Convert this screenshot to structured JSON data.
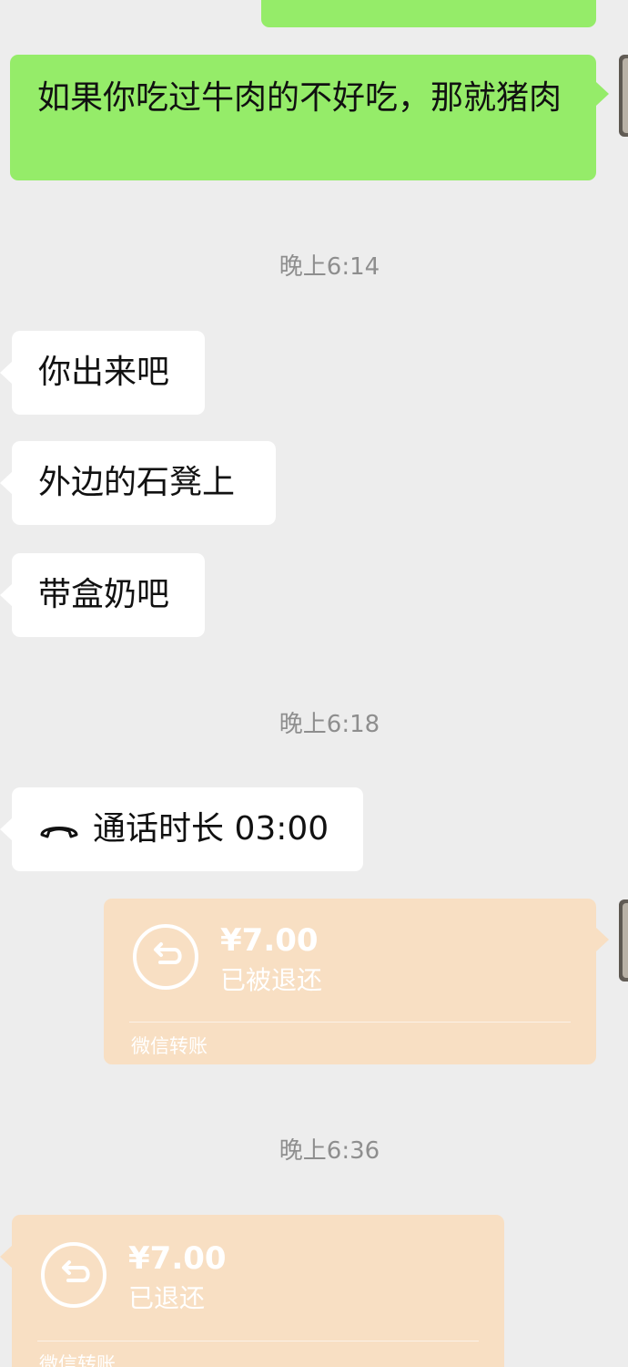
{
  "messages": {
    "m1": {
      "text": "如果你吃过牛肉的不好吃，那就猪肉"
    },
    "m2": {
      "text": "你出来吧"
    },
    "m3": {
      "text": "外边的石凳上"
    },
    "m4": {
      "text": "带盒奶吧"
    },
    "call": {
      "text": "通话时长 03:00",
      "icon": "phone-hangup-icon"
    },
    "t1": {
      "amount": "¥7.00",
      "status": "已被退还",
      "footer": "微信转账",
      "icon": "return-arrow-icon"
    },
    "t2": {
      "amount": "¥7.00",
      "status": "已退还",
      "footer": "微信转账",
      "icon": "return-arrow-icon"
    }
  },
  "timestamps": {
    "ts1": "晚上6:14",
    "ts2": "晚上6:18",
    "ts3": "晚上6:36"
  },
  "colors": {
    "background": "#ededed",
    "sent_bubble": "#95ec69",
    "received_bubble": "#ffffff",
    "transfer_card": "#f8dfc3",
    "timestamp_text": "#8e8e8e"
  }
}
